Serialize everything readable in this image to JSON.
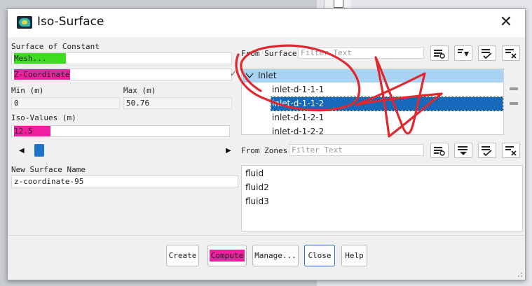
{
  "dialog": {
    "title": "Iso-Surface"
  },
  "surface_of_constant": {
    "label": "Surface of Constant",
    "category_value": "Mesh...",
    "quantity_value": "Z-Coordinate"
  },
  "range": {
    "min_label": "Min (m)",
    "min_value": "0",
    "max_label": "Max (m)",
    "max_value": "50.76"
  },
  "iso_values": {
    "label": "Iso-Values (m)",
    "value": "12.5"
  },
  "new_surface": {
    "label": "New Surface Name",
    "value": "z-coordinate-95"
  },
  "from_surface": {
    "label": "From Surface",
    "filter_placeholder": "Filter Text",
    "tree": {
      "group": "Inlet",
      "items": [
        "inlet-d-1-1-1",
        "inlet-d-1-1-2",
        "inlet-d-1-2-1",
        "inlet-d-1-2-2"
      ],
      "selected_index": 1
    }
  },
  "from_zones": {
    "label": "From Zones",
    "filter_placeholder": "Filter Text",
    "items": [
      "fluid",
      "fluid2",
      "fluid3"
    ]
  },
  "buttons": {
    "create": "Create",
    "compute": "Compute",
    "manage": "Manage...",
    "close": "Close",
    "help": "Help"
  },
  "colors": {
    "highlight_green": "#3ddc1e",
    "highlight_pink": "#f01fa0",
    "annotation_red": "#e0282e",
    "selection_blue": "#1569b8",
    "group_header_blue": "#a9d3f3",
    "slider_blue": "#1a73c8"
  }
}
